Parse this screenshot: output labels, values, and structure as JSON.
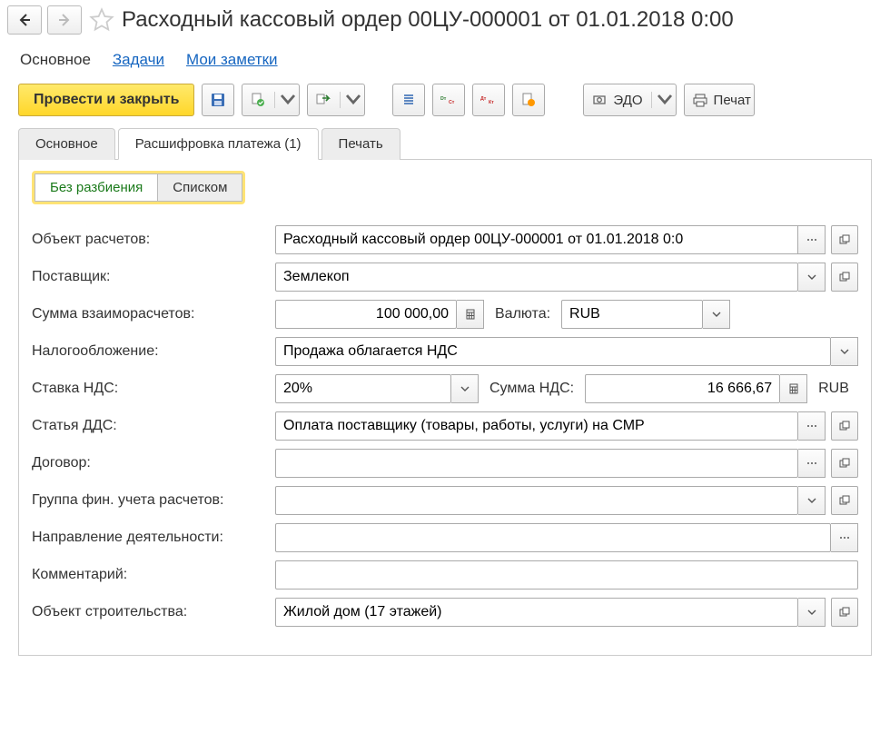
{
  "header": {
    "title": "Расходный кассовый ордер 00ЦУ-000001 от 01.01.2018 0:00"
  },
  "view_tabs": {
    "main": "Основное",
    "tasks": "Задачи",
    "notes": "Мои заметки"
  },
  "toolbar": {
    "post_close": "Провести и закрыть",
    "edo": "ЭДО",
    "print": "Печат"
  },
  "doc_tabs": {
    "main": "Основное",
    "decipher": "Расшифровка платежа (1)",
    "print": "Печать"
  },
  "seg": {
    "no_split": "Без разбиения",
    "list": "Списком"
  },
  "labels": {
    "object_calc": "Объект расчетов:",
    "supplier": "Поставщик:",
    "settle_sum": "Сумма взаиморасчетов:",
    "currency": "Валюта:",
    "taxation": "Налогообложение:",
    "vat_rate": "Ставка НДС:",
    "vat_sum": "Сумма НДС:",
    "dds": "Статья ДДС:",
    "contract": "Договор:",
    "fin_group": "Группа фин. учета расчетов:",
    "activity": "Направление деятельности:",
    "comment": "Комментарий:",
    "construction": "Объект строительства:"
  },
  "values": {
    "object_calc": "Расходный кассовый ордер 00ЦУ-000001 от 01.01.2018 0:0",
    "supplier": "Землекоп",
    "settle_sum": "100 000,00",
    "currency": "RUB",
    "taxation": "Продажа облагается НДС",
    "vat_rate": "20%",
    "vat_sum": "16 666,67",
    "vat_sum_currency": "RUB",
    "dds": "Оплата поставщику (товары, работы, услуги) на СМР",
    "contract": "",
    "fin_group": "",
    "activity": "",
    "comment": "",
    "construction": "Жилой дом (17 этажей)"
  }
}
